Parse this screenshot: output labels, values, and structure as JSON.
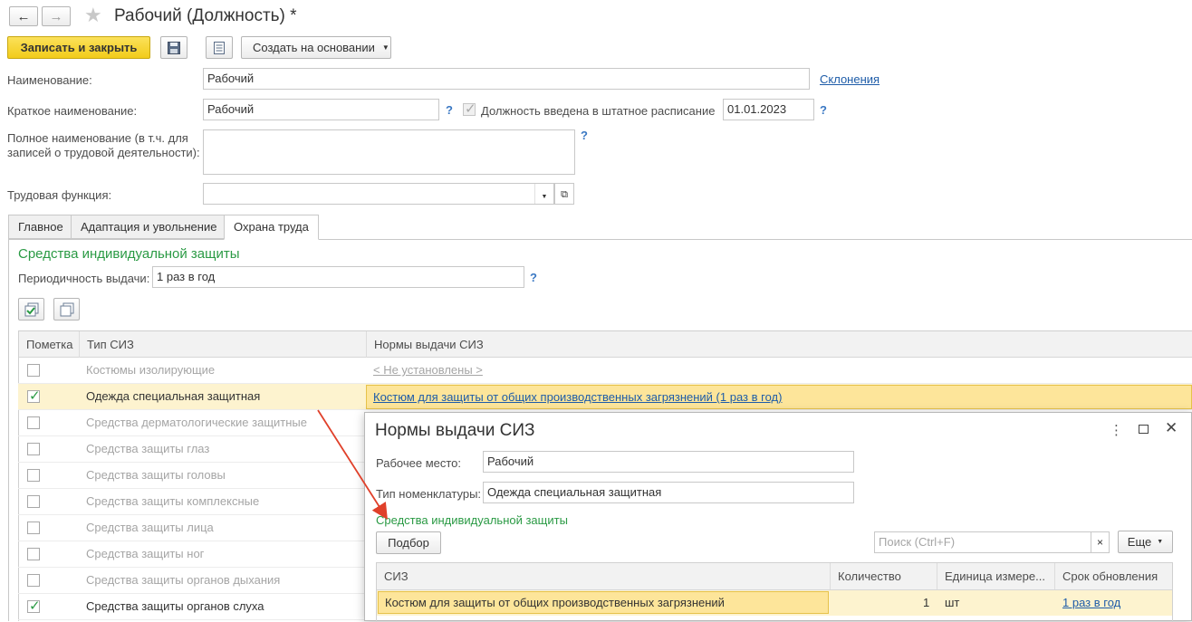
{
  "window": {
    "title": "Рабочий (Должность) *"
  },
  "toolbar": {
    "save_close_label": "Записать и закрыть",
    "create_based_label": "Создать на основании"
  },
  "form": {
    "name_label": "Наименование:",
    "name_value": "Рабочий",
    "declensions_link": "Склонения",
    "short_name_label": "Краткое наименование:",
    "short_name_value": "Рабочий",
    "staff_checkbox_label": "Должность введена в штатное расписание",
    "staff_date": "01.01.2023",
    "full_name_label_1": "Полное наименование (в т.ч. для",
    "full_name_label_2": "записей о трудовой деятельности):",
    "labor_function_label": "Трудовая функция:",
    "help_mark": "?"
  },
  "tabs": [
    {
      "label": "Главное"
    },
    {
      "label": "Адаптация и увольнение"
    },
    {
      "label": "Охрана труда"
    }
  ],
  "ppe_section": {
    "title": "Средства индивидуальной защиты",
    "periodicity_label": "Периодичность выдачи:",
    "periodicity_value": "1 раз в год"
  },
  "ppe_table": {
    "columns": [
      "Пометка",
      "Тип СИЗ",
      "Нормы выдачи СИЗ"
    ],
    "rows": [
      {
        "type": "Костюмы изолирующие",
        "norm": "< Не установлены >",
        "checked": false
      },
      {
        "type": "Одежда специальная защитная",
        "norm": "Костюм для защиты от общих производственных загрязнений (1 раз в год)",
        "checked": true
      },
      {
        "type": "Средства дерматологические защитные",
        "norm": "",
        "checked": false
      },
      {
        "type": "Средства защиты глаз",
        "norm": "",
        "checked": false
      },
      {
        "type": "Средства защиты головы",
        "norm": "",
        "checked": false
      },
      {
        "type": "Средства защиты комплексные",
        "norm": "",
        "checked": false
      },
      {
        "type": "Средства защиты лица",
        "norm": "",
        "checked": false
      },
      {
        "type": "Средства защиты ног",
        "norm": "",
        "checked": false
      },
      {
        "type": "Средства защиты органов дыхания",
        "norm": "",
        "checked": false
      },
      {
        "type": "Средства защиты органов слуха",
        "norm": "",
        "checked": true
      }
    ]
  },
  "dialog": {
    "title": "Нормы выдачи СИЗ",
    "workplace_label": "Рабочее место:",
    "workplace_value": "Рабочий",
    "nomenclature_label": "Тип номенклатуры:",
    "nomenclature_value": "Одежда специальная защитная",
    "section_title": "Средства индивидуальной защиты",
    "select_button": "Подбор",
    "search_placeholder": "Поиск (Ctrl+F)",
    "more_button": "Еще",
    "columns": [
      "СИЗ",
      "Количество",
      "Единица измере...",
      "Срок обновления"
    ],
    "row": {
      "siz": "Костюм для защиты от общих производственных загрязнений",
      "qty": "1",
      "unit": "шт",
      "term": "1 раз в год"
    }
  },
  "colors": {
    "accent_yellow": "#f7d530",
    "selection_yellow": "#fdeaa0",
    "section_green": "#2a9a44",
    "link_blue": "#1e5ca8",
    "arrow_red": "#e0402a"
  }
}
